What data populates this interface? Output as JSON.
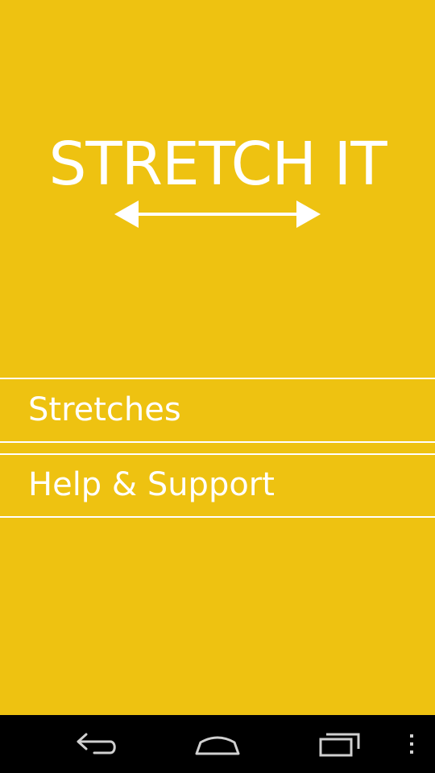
{
  "app": {
    "title": "STRETCH IT",
    "background_color": "#EEC211",
    "text_color": "#FFFFFF"
  },
  "logo": {
    "title": "STRETCH IT",
    "arrow_icon": "double-headed-arrow-icon"
  },
  "menu": {
    "items": [
      {
        "label": "Stretches"
      },
      {
        "label": "Help & Support"
      }
    ]
  },
  "navigation_bar": {
    "background_color": "#000000",
    "buttons": [
      {
        "icon": "back-icon"
      },
      {
        "icon": "home-icon"
      },
      {
        "icon": "recent-apps-icon"
      },
      {
        "icon": "overflow-menu-icon"
      }
    ]
  }
}
